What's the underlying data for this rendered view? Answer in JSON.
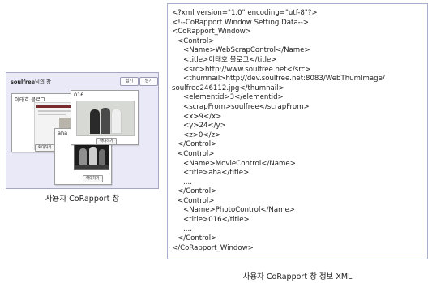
{
  "corapport_window": {
    "user": "soulfree",
    "title_suffix": "님의 창",
    "buttons": {
      "first": "접기",
      "second": "닫기"
    },
    "web_panel": {
      "title": "이태호 블로그",
      "zoom_label": "확대하기"
    },
    "movie_panel": {
      "title": "aha",
      "zoom_label": "확대하기"
    },
    "photo_panel": {
      "title": "016",
      "zoom_label": "확대하기"
    }
  },
  "captions": {
    "left": "사용자 CoRapport 창",
    "right": "사용자 CoRapport 창 정보 XML"
  },
  "xml_lines": [
    "<?xml version=\"1.0\" encoding=\"utf-8\"?>",
    "<!--CoRapport Window Setting Data-->",
    "<CoRapport_Window>",
    "<Control>",
    "<Name>WebScrapControl</Name>",
    "<title>이태호 블로그</title>",
    "<src>http://www.soulfree.net</src>",
    "<thumnail>http://dev.soulfree.net:8083/WebThumImage/",
    "soulfree246112.jpg</thumnail>",
    "<elementid>3</elementid>",
    "<scrapFrom>soulfree</scrapFrom>",
    "<x>9</x>",
    "<y>24</y>",
    "<z>0</z>",
    "</Control>",
    "<Control>",
    "<Name>MovieControl</Name>",
    "<title>aha</title>",
    "....",
    "</Control>",
    "<Control>",
    "<Name>PhotoControl</Name>",
    "<title>016</title>",
    "....",
    "</Control>",
    "</CoRapport_Window>"
  ]
}
